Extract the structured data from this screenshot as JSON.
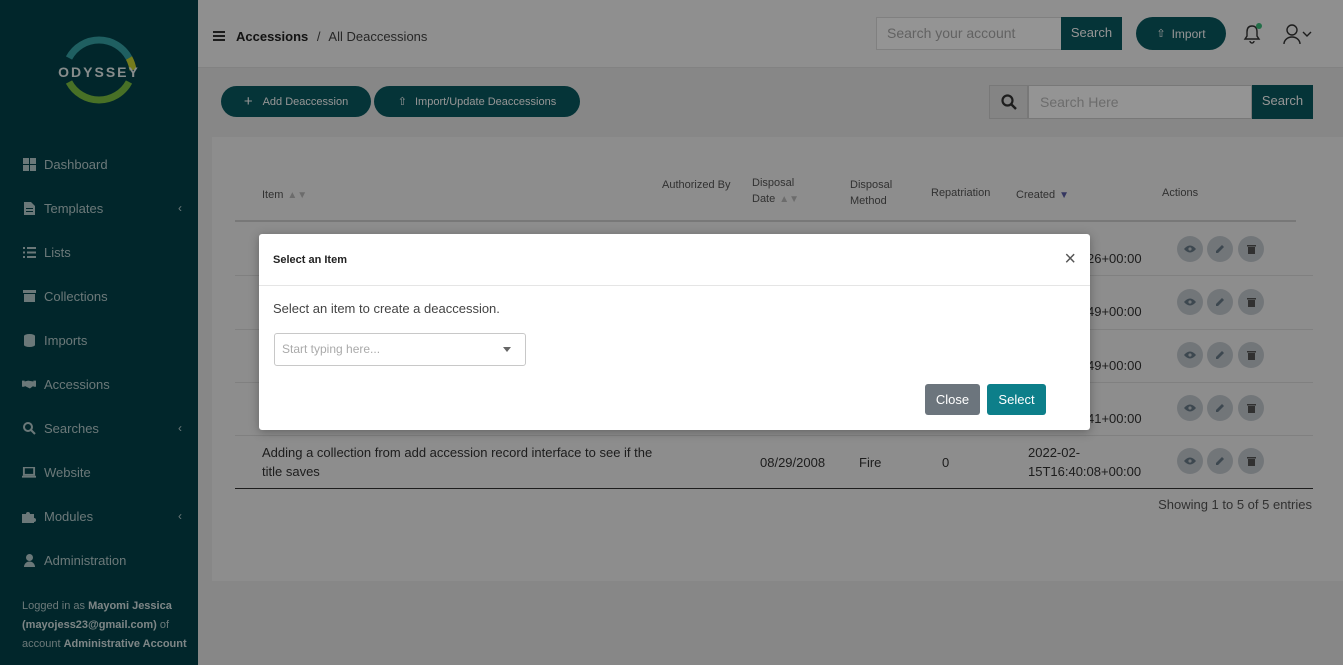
{
  "brand": {
    "name": "ODYSSEY"
  },
  "sidebar": {
    "items": [
      {
        "label": "Dashboard",
        "icon": "dashboard-icon"
      },
      {
        "label": "Templates",
        "icon": "file-icon",
        "chevron": true
      },
      {
        "label": "Lists",
        "icon": "list-icon"
      },
      {
        "label": "Collections",
        "icon": "archive-icon"
      },
      {
        "label": "Imports",
        "icon": "database-icon"
      },
      {
        "label": "Accessions",
        "icon": "handshake-icon"
      },
      {
        "label": "Searches",
        "icon": "search-icon",
        "chevron": true
      },
      {
        "label": "Website",
        "icon": "laptop-icon"
      },
      {
        "label": "Modules",
        "icon": "puzzle-icon",
        "chevron": true
      },
      {
        "label": "Administration",
        "icon": "user-icon"
      }
    ],
    "logged_in": {
      "prefix": "Logged in as ",
      "user": "Mayomi Jessica (mayojess23@gmail.com)",
      "mid": " of account ",
      "account": "Administrative Account"
    }
  },
  "header": {
    "breadcrumb": {
      "root": "Accessions",
      "sep": "/",
      "current": "All Deaccessions"
    },
    "search_placeholder": "Search your account",
    "search_label": "Search",
    "import_label": "Import"
  },
  "toolbar": {
    "add_label": "Add Deaccession",
    "update_label": "Import/Update Deaccessions",
    "search_placeholder": "Search Here",
    "search_label": "Search"
  },
  "table": {
    "columns": {
      "item": "Item",
      "authorized_by": "Authorized By",
      "disposal_date": "Disposal Date",
      "disposal_method": "Disposal Method",
      "repatriation": "Repatriation",
      "created": "Created",
      "actions": "Actions"
    },
    "rows": [
      {
        "created": "26+00:00"
      },
      {
        "created": "49+00:00"
      },
      {
        "created": "49+00:00"
      },
      {
        "created": "41+00:00"
      },
      {
        "item": "Adding a collection from add accession record interface to see if the title saves",
        "disposal_date": "08/29/2008",
        "disposal_method": "Fire",
        "repatriation": "0",
        "created": "2022-02-15T16:40:08+00:00"
      }
    ],
    "showing": "Showing 1 to 5 of 5 entries"
  },
  "modal": {
    "title": "Select an Item",
    "close_glyph": "×",
    "message": "Select an item to create a deaccession.",
    "select_placeholder": "Start typing here...",
    "close_label": "Close",
    "select_label": "Select"
  }
}
